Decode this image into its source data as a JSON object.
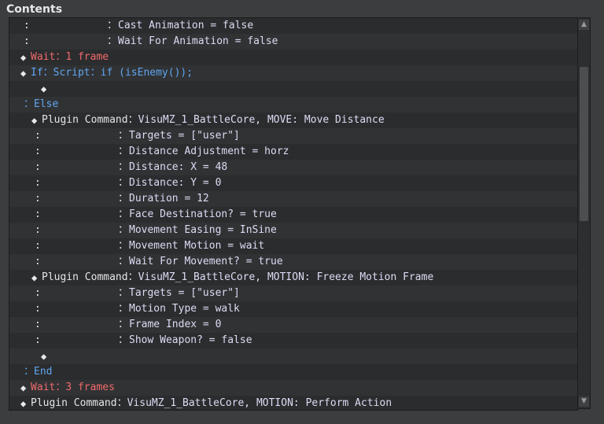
{
  "panel": {
    "title": "Contents"
  },
  "glyphs": {
    "diamond": "◆",
    "colon": ":",
    "scroll_up": "▲",
    "scroll_down": "▼"
  },
  "rows": [
    {
      "kind": "cont",
      "indent": 0,
      "col": 116,
      "text": "Cast Animation = false"
    },
    {
      "kind": "cont",
      "indent": 0,
      "col": 116,
      "text": "Wait For Animation = false"
    },
    {
      "kind": "cmd",
      "indent": 0,
      "parts": [
        {
          "t": "Wait",
          "c": "red"
        },
        {
          "t": "：",
          "c": "red"
        },
        {
          "t": "1 frame",
          "c": "red"
        }
      ]
    },
    {
      "kind": "cmd",
      "indent": 0,
      "parts": [
        {
          "t": "If",
          "c": "blue"
        },
        {
          "t": "：",
          "c": "blue"
        },
        {
          "t": "Script",
          "c": "blue"
        },
        {
          "t": "：",
          "c": "blue"
        },
        {
          "t": "if (isEnemy());",
          "c": "blue"
        }
      ]
    },
    {
      "kind": "empty",
      "indent": 14
    },
    {
      "kind": "branch",
      "indent": 0,
      "parts": [
        {
          "t": "：",
          "c": "blue"
        },
        {
          "t": "Else",
          "c": "blue"
        }
      ]
    },
    {
      "kind": "cmd",
      "indent": 14,
      "parts": [
        {
          "t": "Plugin Command",
          "c": "light"
        },
        {
          "t": "：",
          "c": "light"
        },
        {
          "t": "VisuMZ_1_BattleCore, MOVE: Move Distance",
          "c": "lav"
        }
      ]
    },
    {
      "kind": "cont",
      "indent": 14,
      "col": 116,
      "text": "Targets = [\"user\"]"
    },
    {
      "kind": "cont",
      "indent": 14,
      "col": 116,
      "text": "Distance Adjustment = horz"
    },
    {
      "kind": "cont",
      "indent": 14,
      "col": 116,
      "text": "Distance: X = 48"
    },
    {
      "kind": "cont",
      "indent": 14,
      "col": 116,
      "text": "Distance: Y = 0"
    },
    {
      "kind": "cont",
      "indent": 14,
      "col": 116,
      "text": "Duration = 12"
    },
    {
      "kind": "cont",
      "indent": 14,
      "col": 116,
      "text": "Face Destination? = true"
    },
    {
      "kind": "cont",
      "indent": 14,
      "col": 116,
      "text": "Movement Easing = InSine"
    },
    {
      "kind": "cont",
      "indent": 14,
      "col": 116,
      "text": "Movement Motion = wait"
    },
    {
      "kind": "cont",
      "indent": 14,
      "col": 116,
      "text": "Wait For Movement? = true"
    },
    {
      "kind": "cmd",
      "indent": 14,
      "parts": [
        {
          "t": "Plugin Command",
          "c": "light"
        },
        {
          "t": "：",
          "c": "light"
        },
        {
          "t": "VisuMZ_1_BattleCore, MOTION: Freeze Motion Frame",
          "c": "lav"
        }
      ]
    },
    {
      "kind": "cont",
      "indent": 14,
      "col": 116,
      "text": "Targets = [\"user\"]"
    },
    {
      "kind": "cont",
      "indent": 14,
      "col": 116,
      "text": "Motion Type = walk"
    },
    {
      "kind": "cont",
      "indent": 14,
      "col": 116,
      "text": "Frame Index = 0"
    },
    {
      "kind": "cont",
      "indent": 14,
      "col": 116,
      "text": "Show Weapon? = false"
    },
    {
      "kind": "empty",
      "indent": 14
    },
    {
      "kind": "branch",
      "indent": 0,
      "parts": [
        {
          "t": "：",
          "c": "blue"
        },
        {
          "t": "End",
          "c": "blue"
        }
      ]
    },
    {
      "kind": "cmd",
      "indent": 0,
      "parts": [
        {
          "t": "Wait",
          "c": "red"
        },
        {
          "t": "：",
          "c": "red"
        },
        {
          "t": "3 frames",
          "c": "red"
        }
      ]
    },
    {
      "kind": "cmd",
      "indent": 0,
      "parts": [
        {
          "t": "Plugin Command",
          "c": "light"
        },
        {
          "t": "：",
          "c": "light"
        },
        {
          "t": "VisuMZ_1_BattleCore, MOTION: Perform Action",
          "c": "lav"
        }
      ]
    }
  ]
}
